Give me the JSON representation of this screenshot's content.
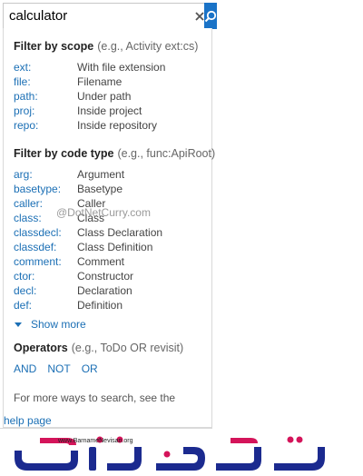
{
  "search": {
    "value": "calculator",
    "clear_icon": "close-icon",
    "search_icon": "search-icon"
  },
  "scope": {
    "title": "Filter by scope",
    "hint": "(e.g., Activity ext:cs)",
    "items": [
      {
        "key": "ext:",
        "desc": "With file extension"
      },
      {
        "key": "file:",
        "desc": "Filename"
      },
      {
        "key": "path:",
        "desc": "Under path"
      },
      {
        "key": "proj:",
        "desc": "Inside project"
      },
      {
        "key": "repo:",
        "desc": "Inside repository"
      }
    ]
  },
  "code_type": {
    "title": "Filter by code type",
    "hint": "(e.g., func:ApiRoot)",
    "items": [
      {
        "key": "arg:",
        "desc": "Argument"
      },
      {
        "key": "basetype:",
        "desc": "Basetype"
      },
      {
        "key": "caller:",
        "desc": "Caller"
      },
      {
        "key": "class:",
        "desc": "Class"
      },
      {
        "key": "classdecl:",
        "desc": "Class Declaration"
      },
      {
        "key": "classdef:",
        "desc": "Class Definition"
      },
      {
        "key": "comment:",
        "desc": "Comment"
      },
      {
        "key": "ctor:",
        "desc": "Constructor"
      },
      {
        "key": "decl:",
        "desc": "Declaration"
      },
      {
        "key": "def:",
        "desc": "Definition"
      }
    ]
  },
  "show_more": "Show more",
  "operators": {
    "title": "Operators",
    "hint": "(e.g., ToDo OR revisit)",
    "items": [
      "AND",
      "NOT",
      "OR"
    ]
  },
  "footer": {
    "text": "For more ways to search, see the",
    "link": "help page"
  },
  "watermark": "@DotNetCurry.com",
  "logo": {
    "small_text": "www.BarnameNevisan.org",
    "colors": {
      "primary": "#1b2a8f",
      "accent": "#d4145a"
    }
  },
  "colors": {
    "link": "#1b6fb5",
    "search_button": "#1a73c7"
  }
}
